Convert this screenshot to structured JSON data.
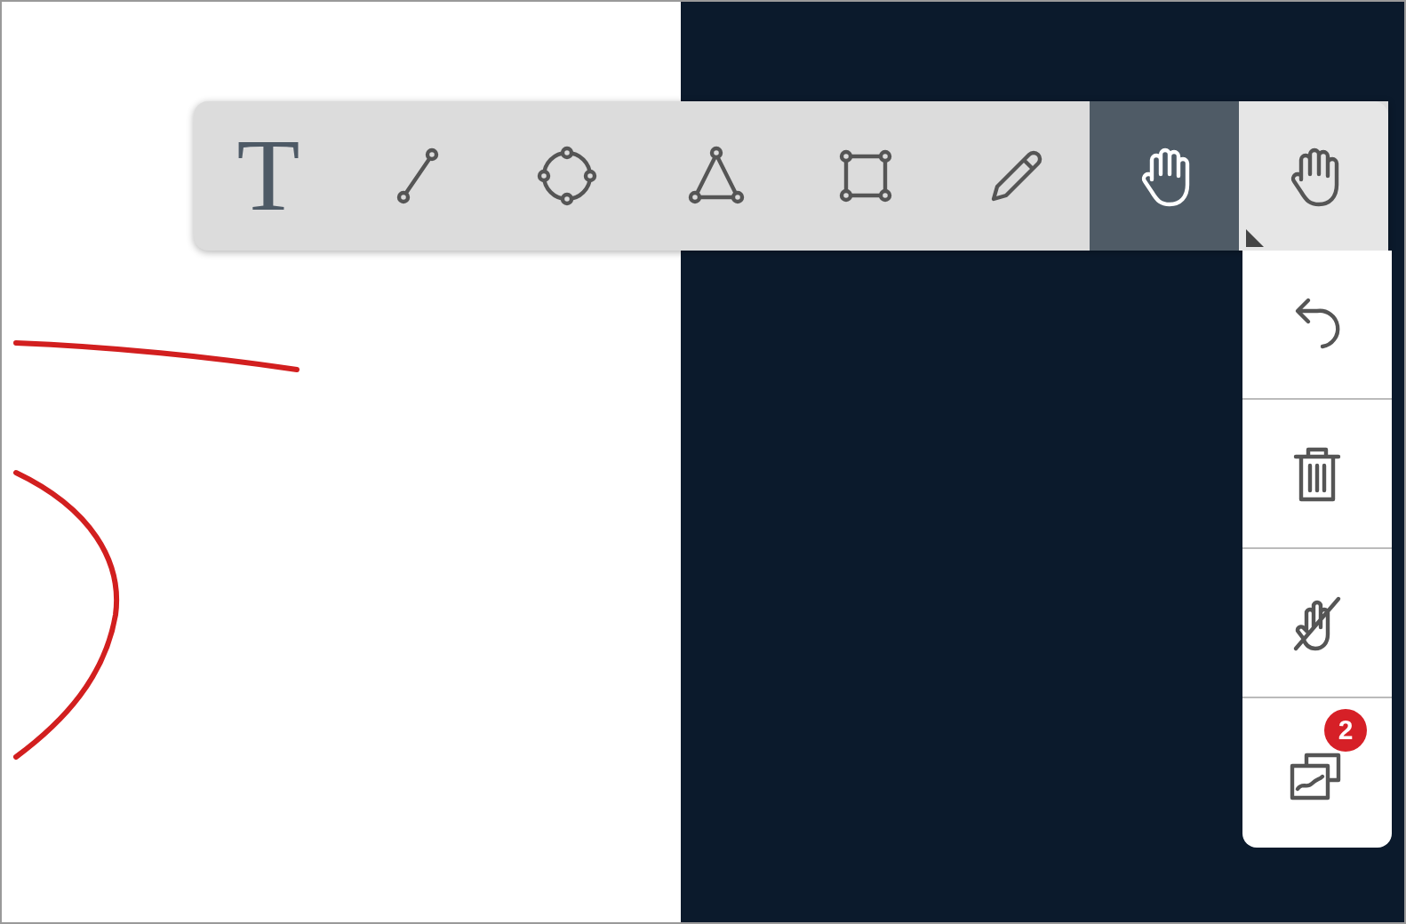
{
  "toolbar": {
    "tools": [
      {
        "kind": "text",
        "label": "T",
        "selected": false
      },
      {
        "kind": "line",
        "selected": false
      },
      {
        "kind": "circle",
        "selected": false
      },
      {
        "kind": "triangle",
        "selected": false
      },
      {
        "kind": "rectangle",
        "selected": false
      },
      {
        "kind": "pencil",
        "selected": false
      },
      {
        "kind": "hand",
        "selected": true
      },
      {
        "kind": "hand-menu",
        "selected": false
      }
    ]
  },
  "side_panel": {
    "buttons": [
      {
        "kind": "undo"
      },
      {
        "kind": "trash"
      },
      {
        "kind": "no-touch"
      },
      {
        "kind": "slides",
        "badge": "2"
      }
    ]
  }
}
